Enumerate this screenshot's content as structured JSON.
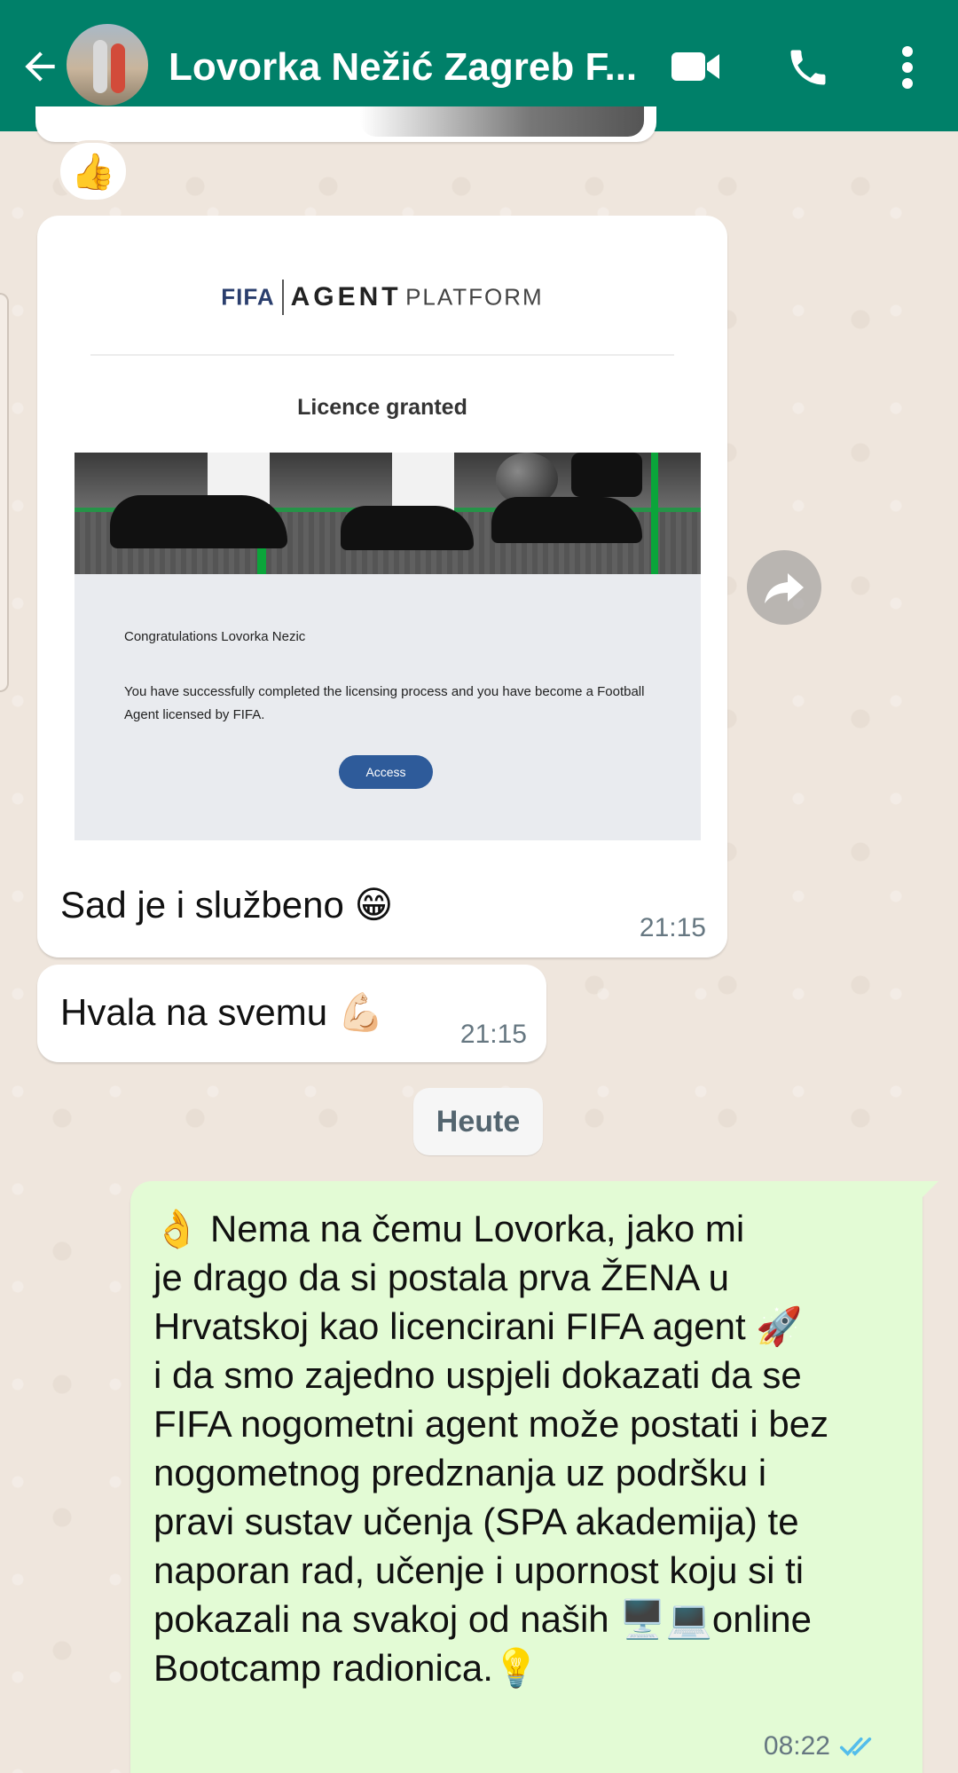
{
  "header": {
    "contact_name": "Lovorka Nežić Zagreb F...",
    "background_color": "#008069",
    "icons": [
      "back-arrow-icon",
      "avatar",
      "video-call-icon",
      "phone-icon",
      "more-vert-icon"
    ]
  },
  "reaction": {
    "emoji": "👍"
  },
  "image_message": {
    "email": {
      "logo_fifa": "FIFA",
      "logo_agent": "AGENT",
      "logo_platform": "PLATFORM",
      "title": "Licence granted",
      "greeting": "Congratulations Lovorka Nezic",
      "body": "You have successfully completed the licensing process and you have become a Football Agent licensed by FIFA.",
      "button_label": "Access"
    },
    "caption": "Sad je i službeno 😁",
    "time": "21:15"
  },
  "forward_button": {
    "icon": "forward-icon"
  },
  "message_thanks": {
    "text": "Hvala na svemu 💪🏻",
    "time": "21:15"
  },
  "date_separator": "Heute",
  "outgoing_message": {
    "text": "👌 Nema na čemu Lovorka, jako mi\nje drago da si postala prva ŽENA u\nHrvatskoj kao licencirani FIFA agent 🚀\ni da smo zajedno uspjeli dokazati da se\nFIFA nogometni agent može postati i bez\nnogometnog predznanja uz podršku i\npravi sustav učenja (SPA akademija) te\nnaporan rad, učenje i upornost koju si ti\npokazali na svakoj od naših 🖥️💻online\nBootcamp radionica.💡",
    "time": "08:22",
    "status": "read",
    "status_color": "#53bdeb"
  }
}
